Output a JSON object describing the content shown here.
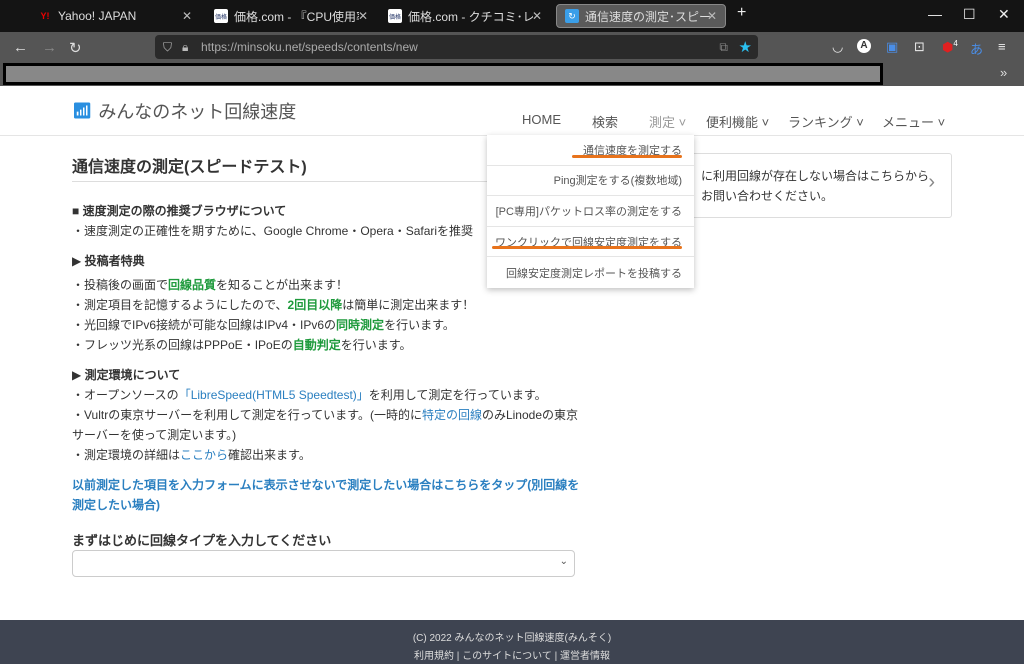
{
  "browser": {
    "tabs": [
      {
        "title": "Yahoo! JAPAN",
        "favicon": "Y!"
      },
      {
        "title": "価格.com - 『CPU使用率が異常",
        "favicon": "価格"
      },
      {
        "title": "価格.com - クチコミ･レビュー",
        "favicon": "価格"
      },
      {
        "title": "通信速度の測定･スピードテスト |",
        "favicon": "↻"
      }
    ],
    "new_tab": "+",
    "url": "https://minsoku.net/speeds/contents/new",
    "extension_badge": "4"
  },
  "site": {
    "logo": "みんなのネット回線速度",
    "nav": [
      "HOME",
      "検索",
      "測定",
      "便利機能",
      "ランキング",
      "メニュー"
    ],
    "dropdown": [
      "通信速度を測定する",
      "Ping測定をする(複数地域)",
      "[PC専用]パケットロス率の測定をする",
      "ワンクリックで回線安定度測定をする",
      "回線安定度測定レポートを投稿する"
    ],
    "info_box": {
      "line1": "に利用回線が存在しない場合はこちらから",
      "line2": "お問い合わせください。"
    }
  },
  "main": {
    "title": "通信速度の測定(スピードテスト)",
    "s1_heading": "■ 速度測定の際の推奨ブラウザについて",
    "s1_line": "・速度測定の正確性を期すために、Google Chrome・Opera・Safariを推奨",
    "s2_heading": "▶ 投稿者特典",
    "s2": [
      [
        "・投稿後の画面で",
        "回線品質",
        "を知ることが出来ます！"
      ],
      [
        "・測定項目を記憶するようにしたので、",
        "2回目以降",
        "は簡単に測定出来ます！"
      ],
      [
        "・光回線でIPv6接続が可能な回線はIPv4・IPv6の",
        "同時測定",
        "を行います。"
      ],
      [
        "・フレッツ光系の回線はPPPoE・IPoEの",
        "自動判定",
        "を行います。"
      ]
    ],
    "s3_heading": "▶ 測定環境について",
    "s3": [
      [
        "・オープンソースの",
        "「LibreSpeed(HTML5 Speedtest)」",
        "を利用して測定を行っています。"
      ],
      [
        "・Vultrの東京サーバーを利用して測定を行っています。(一時的に",
        "特定の回線",
        "のみLinodeの東京サーバーを使って測定います。)"
      ],
      [
        "・測定環境の詳細は",
        "ここから",
        "確認出来ます。"
      ]
    ],
    "skip_link": "以前測定した項目を入力フォームに表示させないで測定したい場合はこちらをタップ(別回線を測定したい場合)",
    "line_type_label": "まずはじめに回線タイプを入力してください",
    "line_type_value": ""
  },
  "footer": {
    "copyright": "(C) 2022  みんなのネット回線速度(みんそく)",
    "links": [
      "利用規約",
      "このサイトについて",
      "運営者情報"
    ],
    "sep": "|"
  }
}
